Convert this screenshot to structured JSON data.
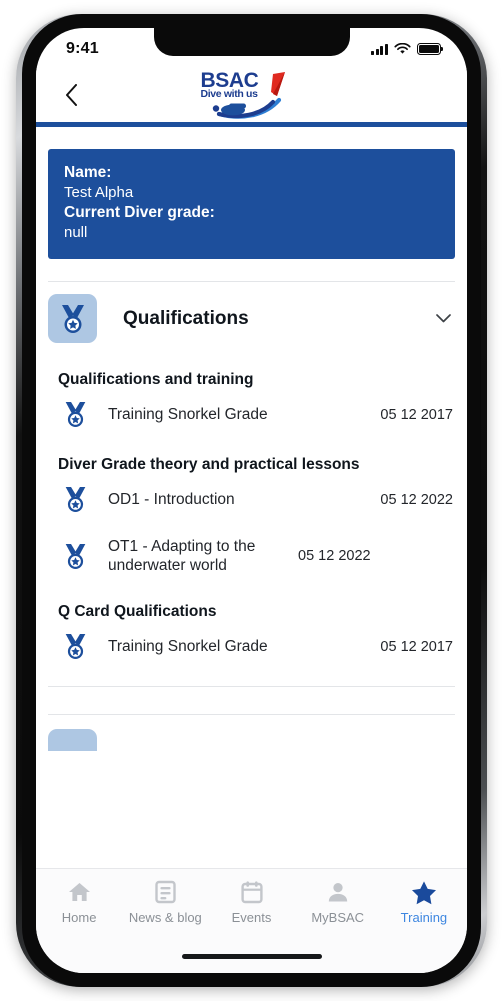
{
  "status_bar": {
    "time": "9:41",
    "signal_icon": "cellular-signal-icon",
    "wifi_icon": "wifi-icon",
    "battery_icon": "battery-full-icon"
  },
  "header": {
    "back_icon": "back-chevron-icon",
    "logo_text": "BSAC",
    "logo_tagline": "Dive with us",
    "logo_mark": "bsac-diver-swoosh-logo",
    "accent_color": "#1d4f9c"
  },
  "info_card": {
    "name_label": "Name:",
    "name_value": "Test Alpha",
    "grade_label": "Current Diver grade:",
    "grade_value": "null",
    "background_color": "#1d4f9c"
  },
  "section": {
    "icon": "medal-icon",
    "title": "Qualifications",
    "expand_icon": "chevron-down-icon",
    "expanded": true
  },
  "groups": [
    {
      "title": "Qualifications and training",
      "items": [
        {
          "icon": "medal-icon",
          "label": "Training Snorkel Grade",
          "date": "05 12 2017"
        }
      ]
    },
    {
      "title": "Diver Grade theory and practical lessons",
      "items": [
        {
          "icon": "medal-icon",
          "label": "OD1 - Introduction",
          "date": "05 12 2022"
        },
        {
          "icon": "medal-icon",
          "label": "OT1 - Adapting to the underwater world",
          "date": "05 12 2022"
        }
      ]
    },
    {
      "title": "Q Card Qualifications",
      "items": [
        {
          "icon": "medal-icon",
          "label": "Training Snorkel Grade",
          "date": "05 12 2017"
        }
      ]
    }
  ],
  "tabbar": {
    "items": [
      {
        "label": "Home",
        "icon": "home-icon"
      },
      {
        "label": "News & blog",
        "icon": "article-icon"
      },
      {
        "label": "Events",
        "icon": "calendar-icon"
      },
      {
        "label": "MyBSAC",
        "icon": "person-icon"
      },
      {
        "label": "Training",
        "icon": "star-icon"
      }
    ],
    "active_index": 4,
    "active_color": "#3d86e0",
    "inactive_color": "#8b9096"
  }
}
